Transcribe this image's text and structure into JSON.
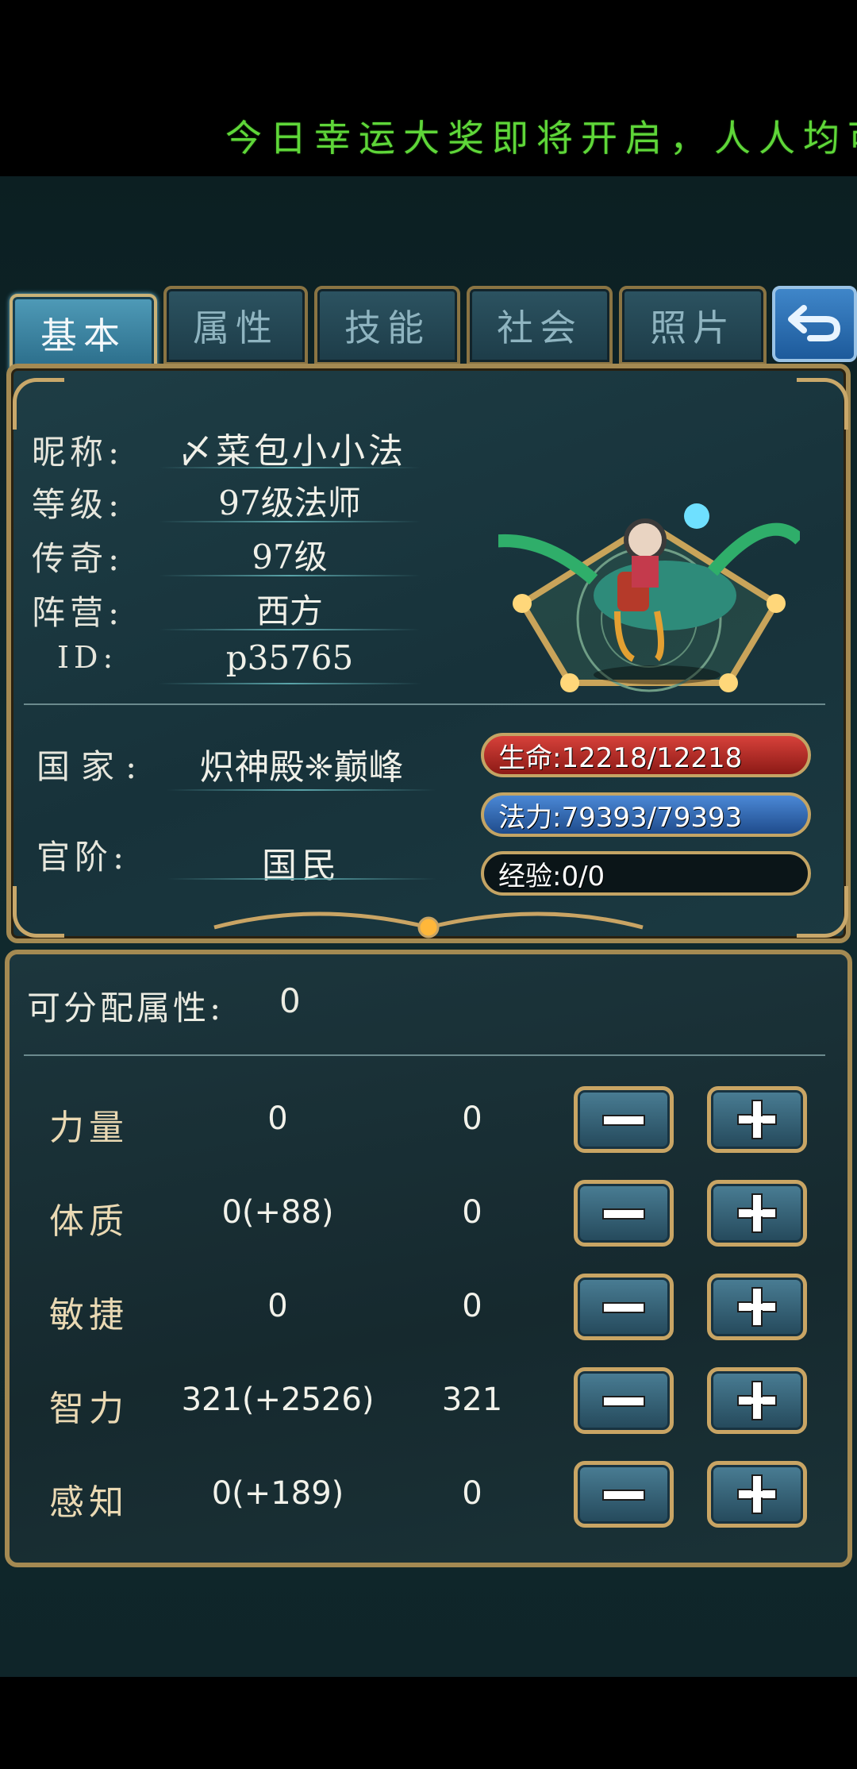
{
  "marquee": "今日幸运大奖即将开启，人人均可",
  "tabs": [
    {
      "label": "基本",
      "active": true
    },
    {
      "label": "属性",
      "active": false
    },
    {
      "label": "技能",
      "active": false
    },
    {
      "label": "社会",
      "active": false
    },
    {
      "label": "照片",
      "active": false
    }
  ],
  "info": {
    "nickname_label": "昵称:",
    "nickname": "〆菜包小小法",
    "level_label": "等级:",
    "level": "97级法师",
    "legend_label": "传奇:",
    "legend": "97级",
    "camp_label": "阵营:",
    "camp": "西方",
    "id_label": "ID:",
    "id": "p35765",
    "country_label": "国家:",
    "country": "炽神殿❈巅峰",
    "rank_label": "官阶:",
    "rank": "国民"
  },
  "bars": {
    "hp": "生命:12218/12218",
    "mp": "法力:79393/79393",
    "exp": "经验:0/0"
  },
  "attributes": {
    "available_label": "可分配属性:",
    "available_value": "0",
    "rows": [
      {
        "name": "力量",
        "value": "0",
        "allocated": "0"
      },
      {
        "name": "体质",
        "value": "0(+88)",
        "allocated": "0"
      },
      {
        "name": "敏捷",
        "value": "0",
        "allocated": "0"
      },
      {
        "name": "智力",
        "value": "321(+2526)",
        "allocated": "321"
      },
      {
        "name": "感知",
        "value": "0(+189)",
        "allocated": "0"
      }
    ]
  },
  "colors": {
    "marquee": "#5fd639",
    "gold_border": "#a48a52",
    "hp": "#d7413a",
    "mp": "#4b88d6"
  }
}
